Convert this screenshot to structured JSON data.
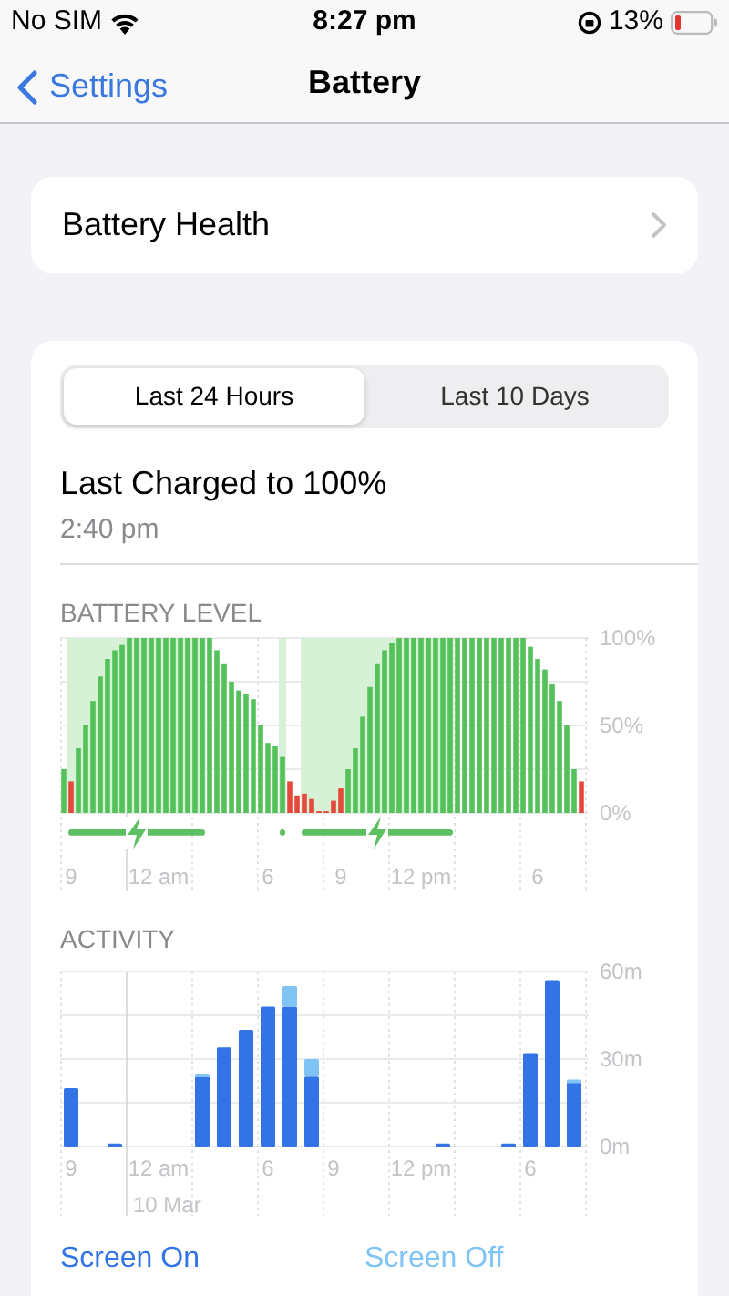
{
  "status_bar": {
    "carrier": "No SIM",
    "time": "8:27 pm",
    "battery": "13%"
  },
  "nav": {
    "back": "Settings",
    "title": "Battery"
  },
  "battery_health": {
    "label": "Battery Health"
  },
  "tabs": [
    {
      "label": "Last 24 Hours",
      "selected": true
    },
    {
      "label": "Last 10 Days",
      "selected": false
    }
  ],
  "last_charged": {
    "title": "Last Charged to 100%",
    "time": "2:40 pm"
  },
  "battery_level": {
    "heading": "BATTERY LEVEL",
    "chart_data": {
      "type": "bar",
      "ylim": [
        0,
        100
      ],
      "values": [
        25,
        18,
        37,
        50,
        64,
        78,
        88,
        93,
        96,
        100,
        100,
        100,
        100,
        100,
        100,
        100,
        100,
        100,
        100,
        100,
        100,
        93,
        85,
        75,
        70,
        68,
        65,
        50,
        40,
        38,
        32,
        18,
        10,
        11,
        8,
        1,
        1,
        7,
        14,
        25,
        37,
        55,
        72,
        85,
        93,
        97,
        100,
        100,
        100,
        100,
        100,
        100,
        100,
        100,
        100,
        100,
        100,
        100,
        100,
        100,
        100,
        100,
        100,
        100,
        95,
        88,
        82,
        74,
        64,
        50,
        25,
        18
      ],
      "yticks": [
        {
          "value": 0,
          "label": "0%"
        },
        {
          "value": 50,
          "label": "50%"
        },
        {
          "value": 100,
          "label": "100%"
        }
      ],
      "categories": [
        null,
        "9",
        null,
        null,
        null,
        null,
        null,
        null,
        null,
        null,
        null,
        null,
        null,
        "12 am",
        null,
        null,
        null,
        null,
        null,
        null,
        null,
        null,
        null,
        null,
        null,
        null,
        null,
        null,
        "6",
        null,
        null,
        null,
        null,
        null,
        null,
        null,
        null,
        null,
        "9",
        null,
        null,
        null,
        null,
        null,
        null,
        null,
        null,
        null,
        null,
        "12 pm",
        null,
        null,
        null,
        null,
        null,
        null,
        null,
        null,
        null,
        null,
        null,
        null,
        null,
        null,
        null,
        "6",
        null,
        null,
        null,
        null,
        null,
        null
      ]
    },
    "charging": [
      false,
      true,
      true,
      true,
      true,
      true,
      true,
      true,
      true,
      true,
      true,
      true,
      true,
      true,
      true,
      true,
      true,
      true,
      true,
      true,
      false,
      false,
      false,
      false,
      false,
      false,
      false,
      false,
      false,
      false,
      true,
      false,
      false,
      true,
      true,
      true,
      true,
      true,
      true,
      true,
      true,
      true,
      true,
      true,
      true,
      true,
      true,
      true,
      true,
      true,
      true,
      true,
      true,
      true,
      false,
      false,
      false,
      false,
      false,
      false,
      false,
      false,
      false,
      false,
      false,
      false,
      false,
      false,
      false,
      false,
      false,
      false
    ]
  },
  "activity": {
    "heading": "ACTIVITY",
    "date_label": "10 Mar",
    "chart_data": {
      "type": "bar",
      "stacked": true,
      "ylim": [
        0,
        60
      ],
      "categories": [
        "9",
        null,
        null,
        null,
        "12 am",
        null,
        null,
        null,
        null,
        "6",
        null,
        null,
        "9",
        null,
        null,
        null,
        "12 pm",
        null,
        null,
        null,
        null,
        "6",
        null,
        null
      ],
      "series": [
        {
          "name": "Screen On",
          "color": "#3274e6",
          "values": [
            20,
            0,
            1,
            0,
            0,
            0,
            24,
            34,
            40,
            48,
            48,
            24,
            0,
            0,
            0,
            0,
            0,
            1,
            0,
            0,
            1,
            32,
            57,
            22
          ]
        },
        {
          "name": "Screen Off",
          "color": "#7fc4f4",
          "values": [
            0,
            0,
            0,
            0,
            0,
            0,
            1,
            0,
            0,
            0,
            7,
            6,
            0,
            0,
            0,
            0,
            0,
            0,
            0,
            0,
            0,
            0,
            0,
            1
          ]
        }
      ],
      "yticks": [
        {
          "value": 0,
          "label": "0m"
        },
        {
          "value": 30,
          "label": "30m"
        },
        {
          "value": 60,
          "label": "60m"
        }
      ]
    }
  }
}
